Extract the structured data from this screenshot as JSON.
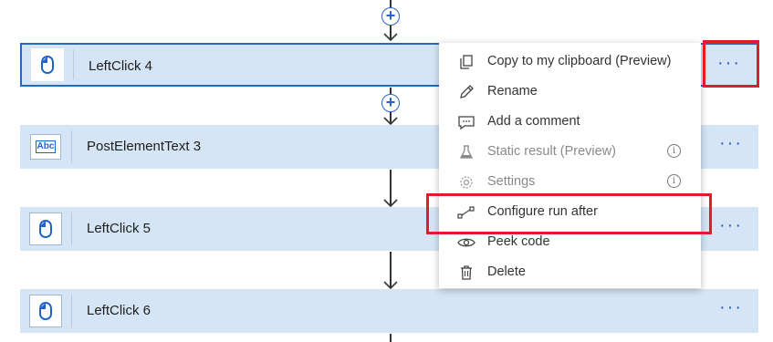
{
  "flow": {
    "cards": [
      {
        "title": "LeftClick 4",
        "icon": "mouse-icon",
        "more": "···"
      },
      {
        "title": "PostElementText 3",
        "icon": "text-input-icon",
        "icon_text": "Abc",
        "more": "···"
      },
      {
        "title": "LeftClick 5",
        "icon": "mouse-icon",
        "more": "···"
      },
      {
        "title": "LeftClick 6",
        "icon": "mouse-icon",
        "more": "···"
      }
    ],
    "add_step_symbol": "+"
  },
  "context_menu": {
    "items": [
      {
        "label": "Copy to my clipboard (Preview)",
        "icon": "copy-icon"
      },
      {
        "label": "Rename",
        "icon": "pencil-icon"
      },
      {
        "label": "Add a comment",
        "icon": "comment-icon"
      },
      {
        "label": "Static result (Preview)",
        "icon": "flask-icon",
        "info": "i"
      },
      {
        "label": "Settings",
        "icon": "gear-icon",
        "info": "i"
      },
      {
        "label": "Configure run after",
        "icon": "run-after-icon"
      },
      {
        "label": "Peek code",
        "icon": "eye-icon"
      },
      {
        "label": "Delete",
        "icon": "trash-icon"
      }
    ]
  },
  "colors": {
    "card_bg": "#d5e5f5",
    "accent": "#1f63c7",
    "highlight": "#e21b2c"
  }
}
